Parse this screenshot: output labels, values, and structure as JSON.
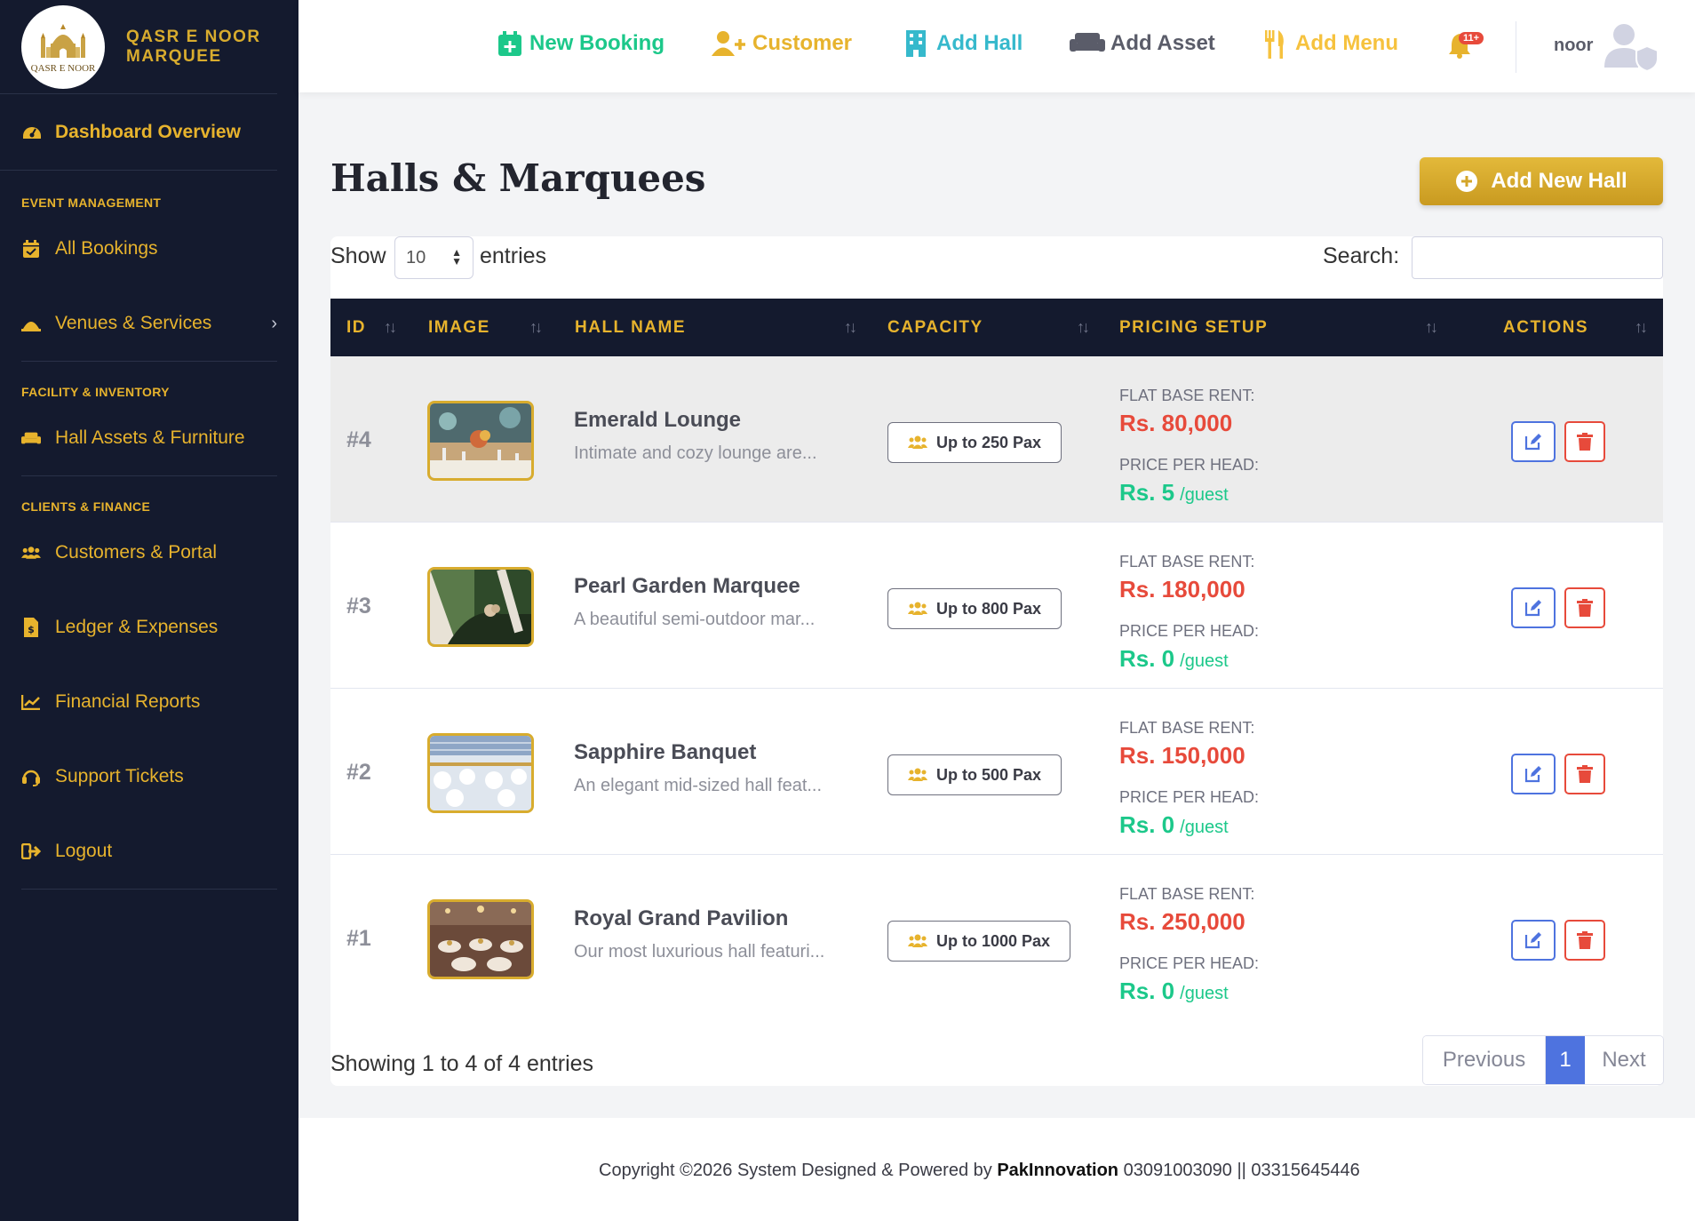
{
  "brand": {
    "name": "QASR E NOOR MARQUEE",
    "logo_text": "QASR E NOOR"
  },
  "sidebar": {
    "dashboard": "Dashboard Overview",
    "sections": [
      {
        "title": "EVENT MANAGEMENT"
      },
      {
        "title": "FACILITY & INVENTORY"
      },
      {
        "title": "CLIENTS & FINANCE"
      }
    ],
    "items": [
      {
        "label": "All Bookings",
        "icon": "calendar-check-icon"
      },
      {
        "label": "Venues & Services",
        "icon": "venue-icon"
      },
      {
        "label": "Hall Assets & Furniture",
        "icon": "couch-icon"
      },
      {
        "label": "Customers & Portal",
        "icon": "users-icon"
      },
      {
        "label": "Ledger & Expenses",
        "icon": "invoice-icon"
      },
      {
        "label": "Financial Reports",
        "icon": "chart-line-icon"
      },
      {
        "label": "Support Tickets",
        "icon": "headset-icon"
      },
      {
        "label": "Logout",
        "icon": "sign-out-icon"
      }
    ]
  },
  "topbar": {
    "links": [
      {
        "label": "New Booking",
        "color": "#1cc88a",
        "icon": "calendar-plus-icon"
      },
      {
        "label": "Customer",
        "color": "#e7b32d",
        "icon": "user-plus-icon"
      },
      {
        "label": "Add Hall",
        "color": "#36b9cc",
        "icon": "building-icon"
      },
      {
        "label": "Add Asset",
        "color": "#5a5c69",
        "icon": "couch-icon"
      },
      {
        "label": "Add Menu",
        "color": "#f6c23e",
        "icon": "utensils-icon"
      }
    ],
    "notifications": "11+",
    "user": "noor"
  },
  "page": {
    "title": "Halls & Marquees",
    "add_button": "Add New Hall",
    "show_label": "Show",
    "entries_value": "10",
    "entries_label": "entries",
    "search_label": "Search:"
  },
  "table": {
    "columns": [
      "ID",
      "IMAGE",
      "HALL NAME",
      "CAPACITY",
      "PRICING SETUP",
      "ACTIONS"
    ],
    "rent_label": "FLAT BASE RENT:",
    "head_label": "PRICE PER HEAD:",
    "per_unit": "/guest",
    "rows": [
      {
        "id": "#4",
        "name": "Emerald Lounge",
        "desc": "Intimate and cozy lounge are...",
        "capacity": "Up to 250 Pax",
        "rent": "Rs. 80,000",
        "per_head": "Rs. 5"
      },
      {
        "id": "#3",
        "name": "Pearl Garden Marquee",
        "desc": "A beautiful semi-outdoor mar...",
        "capacity": "Up to 800 Pax",
        "rent": "Rs. 180,000",
        "per_head": "Rs. 0"
      },
      {
        "id": "#2",
        "name": "Sapphire Banquet",
        "desc": "An elegant mid-sized hall feat...",
        "capacity": "Up to 500 Pax",
        "rent": "Rs. 150,000",
        "per_head": "Rs. 0"
      },
      {
        "id": "#1",
        "name": "Royal Grand Pavilion",
        "desc": "Our most luxurious hall featuri...",
        "capacity": "Up to 1000 Pax",
        "rent": "Rs. 250,000",
        "per_head": "Rs. 0"
      }
    ]
  },
  "pagination": {
    "info": "Showing 1 to 4 of 4 entries",
    "previous": "Previous",
    "current": "1",
    "next": "Next"
  },
  "footer": {
    "prefix": "Copyright ©2026 System Designed & Powered by",
    "company": "PakInnovation",
    "phones": "03091003090 || 03315645446"
  },
  "colors": {
    "sidebar_bg": "#141a2e",
    "gold": "#e7b32d",
    "rent_red": "#e74a3b",
    "head_green": "#1cc88a",
    "primary_blue": "#4e73df"
  }
}
